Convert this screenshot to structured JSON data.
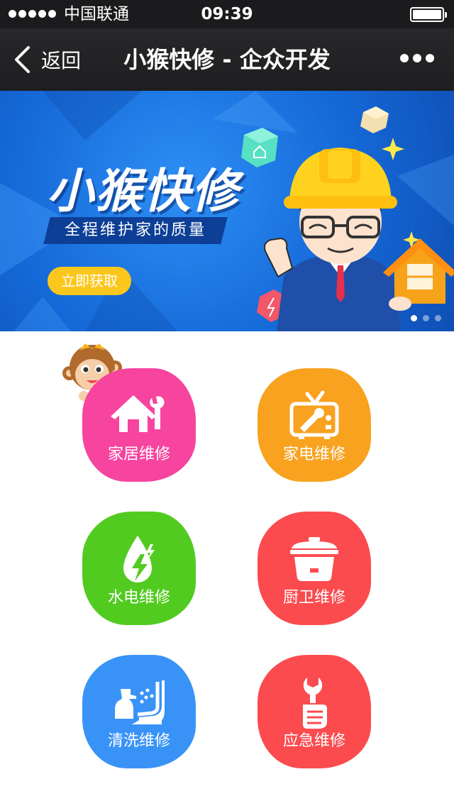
{
  "status_bar": {
    "carrier": "中国联通",
    "time": "09:39"
  },
  "nav": {
    "back_label": "返回",
    "title": "小猴快修 - 企众开发"
  },
  "banner": {
    "title": "小猴快修",
    "subtitle": "全程维护家的质量",
    "cta": "立即获取",
    "slide_count": 3,
    "active_slide": 1
  },
  "services": [
    {
      "label": "家居维修",
      "icon": "house-wrench-icon",
      "color": "#f7449f"
    },
    {
      "label": "家电维修",
      "icon": "tv-icon",
      "color": "#f8a21f"
    },
    {
      "label": "水电维修",
      "icon": "water-bolt-icon",
      "color": "#52cb21"
    },
    {
      "label": "厨卫维修",
      "icon": "rice-cooker-icon",
      "color": "#fb4b4f"
    },
    {
      "label": "清洗维修",
      "icon": "spray-seat-icon",
      "color": "#3993f7"
    },
    {
      "label": "应急维修",
      "icon": "wrench-hand-icon",
      "color": "#fb4b4f"
    }
  ]
}
